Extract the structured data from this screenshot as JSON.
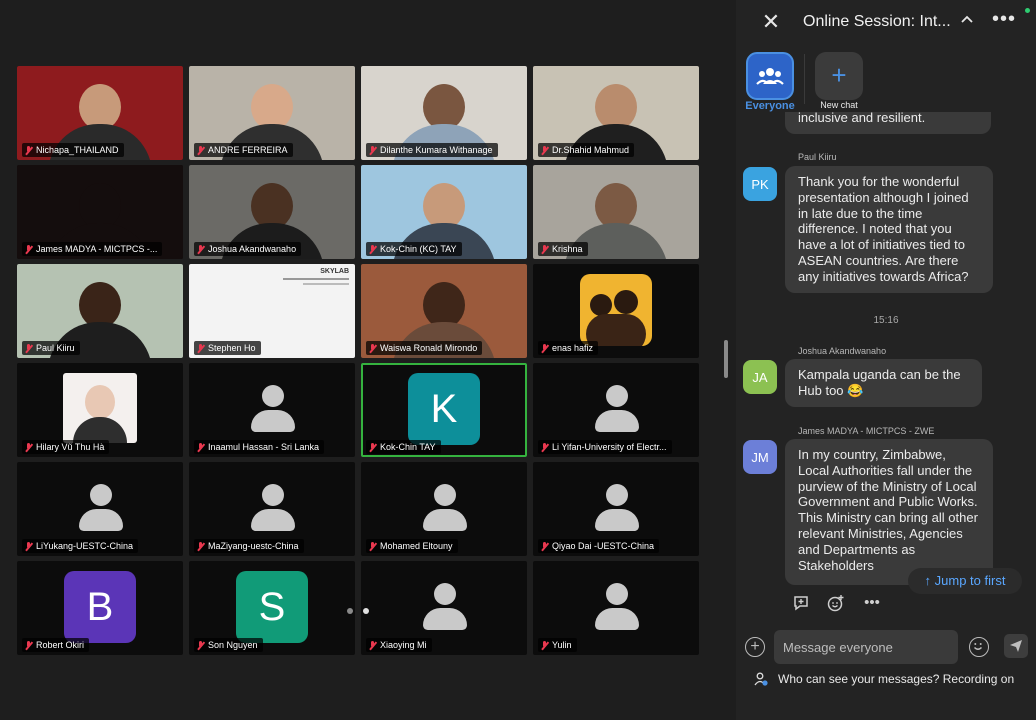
{
  "participants": [
    {
      "name": "Nichapa_THAILAND",
      "kind": "video",
      "bg": "#8e1b1e",
      "skin": "#c79a7a",
      "shirt": "#2a2a2a"
    },
    {
      "name": "ANDRE FERREIRA",
      "kind": "video",
      "bg": "#b9b3a8",
      "skin": "#d8a98a",
      "shirt": "#2f2f2f"
    },
    {
      "name": "Dilanthe Kumara Withanage",
      "kind": "video",
      "bg": "#d8d4cd",
      "skin": "#7a5640",
      "shirt": "#8ea3b8"
    },
    {
      "name": "Dr.Shahid Mahmud",
      "kind": "video",
      "bg": "#c8c2b4",
      "skin": "#b98c6d",
      "shirt": "#1f1f1f"
    },
    {
      "name": "James MADYA - MICTPCS -...",
      "kind": "video",
      "bg": "#140d0d",
      "skin": "#140d0d",
      "shirt": "#140d0d"
    },
    {
      "name": "Joshua Akandwanaho",
      "kind": "video",
      "bg": "#6b6a66",
      "skin": "#4a3122",
      "shirt": "#1c1c1c"
    },
    {
      "name": "Kok-Chin (KC) TAY",
      "kind": "video",
      "bg": "#9ec6df",
      "skin": "#c79a7a",
      "shirt": "#3a4654"
    },
    {
      "name": "Krishna",
      "kind": "video",
      "bg": "#a8a49c",
      "skin": "#7c5a44",
      "shirt": "#5d5f5c"
    },
    {
      "name": "Paul Kiiru",
      "kind": "video",
      "bg": "#b5c2b2",
      "skin": "#3a2418",
      "shirt": "#1e1e1e"
    },
    {
      "name": "Stephen Ho",
      "kind": "slide",
      "bg": "#f3f3f3",
      "slide_title": "SKYLAB"
    },
    {
      "name": "Waiswa Ronald Mirondo",
      "kind": "video",
      "bg": "#9b5a3c",
      "skin": "#3f2619",
      "shirt": "#6a4b3a"
    },
    {
      "name": "enas hafiz",
      "kind": "image",
      "bg": "#0c0c0c",
      "img": "#f0b430"
    },
    {
      "name": "Hilary Vũ Thu Hà",
      "kind": "photo",
      "bg": "#0c0c0c",
      "skin": "#e8c8b4",
      "shirt": "#2e2e2e"
    },
    {
      "name": "Inaamul Hassan - Sri Lanka",
      "kind": "avatar"
    },
    {
      "name": "Kok-Chin TAY",
      "kind": "letter",
      "letter": "K",
      "color": "#0d8f9a",
      "active": true
    },
    {
      "name": "Li Yifan-University of Electr...",
      "kind": "avatar"
    },
    {
      "name": "LiYukang-UESTC-China",
      "kind": "avatar"
    },
    {
      "name": "MaZiyang-uestc-China",
      "kind": "avatar"
    },
    {
      "name": "Mohamed Eltouny",
      "kind": "avatar"
    },
    {
      "name": "Qiyao Dai -UESTC-China",
      "kind": "avatar"
    },
    {
      "name": "Robert Okiri",
      "kind": "letter",
      "letter": "B",
      "color": "#5b35b7"
    },
    {
      "name": "Son Nguyen",
      "kind": "letter",
      "letter": "S",
      "color": "#119b78"
    },
    {
      "name": "Xiaoying Mi",
      "kind": "avatar"
    },
    {
      "name": "Yulin",
      "kind": "avatar"
    }
  ],
  "pager": {
    "dots": 2
  },
  "panel": {
    "title": "Online Session: Int...",
    "channels": [
      {
        "label": "Everyone",
        "selected": true
      },
      {
        "label": "New chat",
        "selected": false
      }
    ],
    "messages": [
      {
        "sender": "",
        "initials": "",
        "avatar_color": "",
        "text": "inclusive and resilient."
      },
      {
        "sender": "Paul Kiiru",
        "initials": "PK",
        "avatar_color": "#3aa3e0",
        "text": "Thank you for the wonderful presentation although I joined in late due to the time difference. I noted that you have a lot of initiatives tied to ASEAN countries. Are there any initiatives towards Africa?"
      },
      {
        "timestamp": "15:16"
      },
      {
        "sender": "Joshua Akandwanaho",
        "initials": "JA",
        "avatar_color": "#8cc152",
        "text": "Kampala uganda can be the Hub too 😂"
      },
      {
        "sender": "James MADYA - MICTPCS - ZWE",
        "initials": "JM",
        "avatar_color": "#6c7fd8",
        "text": "In my country, Zimbabwe, Local Authorities fall under the purview of the Ministry of Local Government and Public Works.  This Ministry can bring all other relevant Ministries, Agencies and Departments as Stakeholders"
      }
    ],
    "jump_label": "↑ Jump to first",
    "input_placeholder": "Message everyone",
    "visibility_text": "Who can see your messages? Recording on"
  },
  "colors": {
    "accent": "#4a90e2",
    "link": "#5aa7ff",
    "active_speaker": "#35b33f",
    "muted_mic": "#e8384f"
  }
}
